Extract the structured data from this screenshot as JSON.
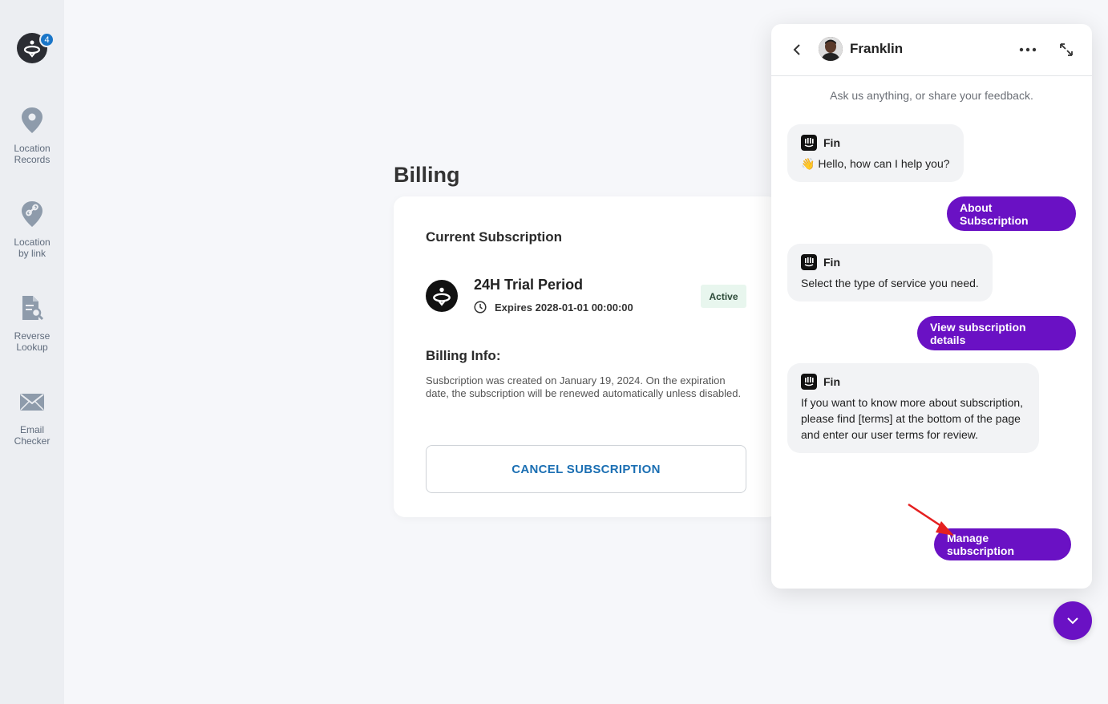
{
  "sidebar": {
    "badge_count": "4",
    "items": [
      {
        "label": "Location\nRecords",
        "icon": "location-pin-icon"
      },
      {
        "label": "Location\nby link",
        "icon": "link-pin-icon"
      },
      {
        "label": "Reverse\nLookup",
        "icon": "document-search-icon"
      },
      {
        "label": "Email\nChecker",
        "icon": "envelope-icon"
      }
    ]
  },
  "billing": {
    "title": "Billing",
    "current_subscription": "Current Subscription",
    "plan_name": "24H Trial Period",
    "expires": "Expires 2028-01-01 00:00:00",
    "status": "Active",
    "info_heading": "Billing Info:",
    "info_text": "Susbcription was created on January 19, 2024. On the expiration date, the subscription will be renewed automatically unless disabled.",
    "cancel_label": "CANCEL SUBSCRIPTION"
  },
  "chat": {
    "agent_name": "Franklin",
    "subtitle": "Ask us anything, or share your feedback.",
    "bot_name": "Fin",
    "messages": [
      {
        "from": "bot",
        "text": "Hello, how can I help you?",
        "emoji": "👋"
      },
      {
        "from": "user",
        "text": "About Subscription"
      },
      {
        "from": "bot",
        "text": "Select the type of service you need."
      },
      {
        "from": "user",
        "text": "View subscription details"
      },
      {
        "from": "bot",
        "text": "If you want to know more about subscription, please find [terms] at the bottom of the page and enter our user terms for review."
      }
    ],
    "action_button": "Manage subscription"
  },
  "colors": {
    "accent_purple": "#6a11c4",
    "link_blue": "#1b6fb3",
    "active_badge_bg": "#e8f6ee",
    "arrow_red": "#e52020"
  }
}
